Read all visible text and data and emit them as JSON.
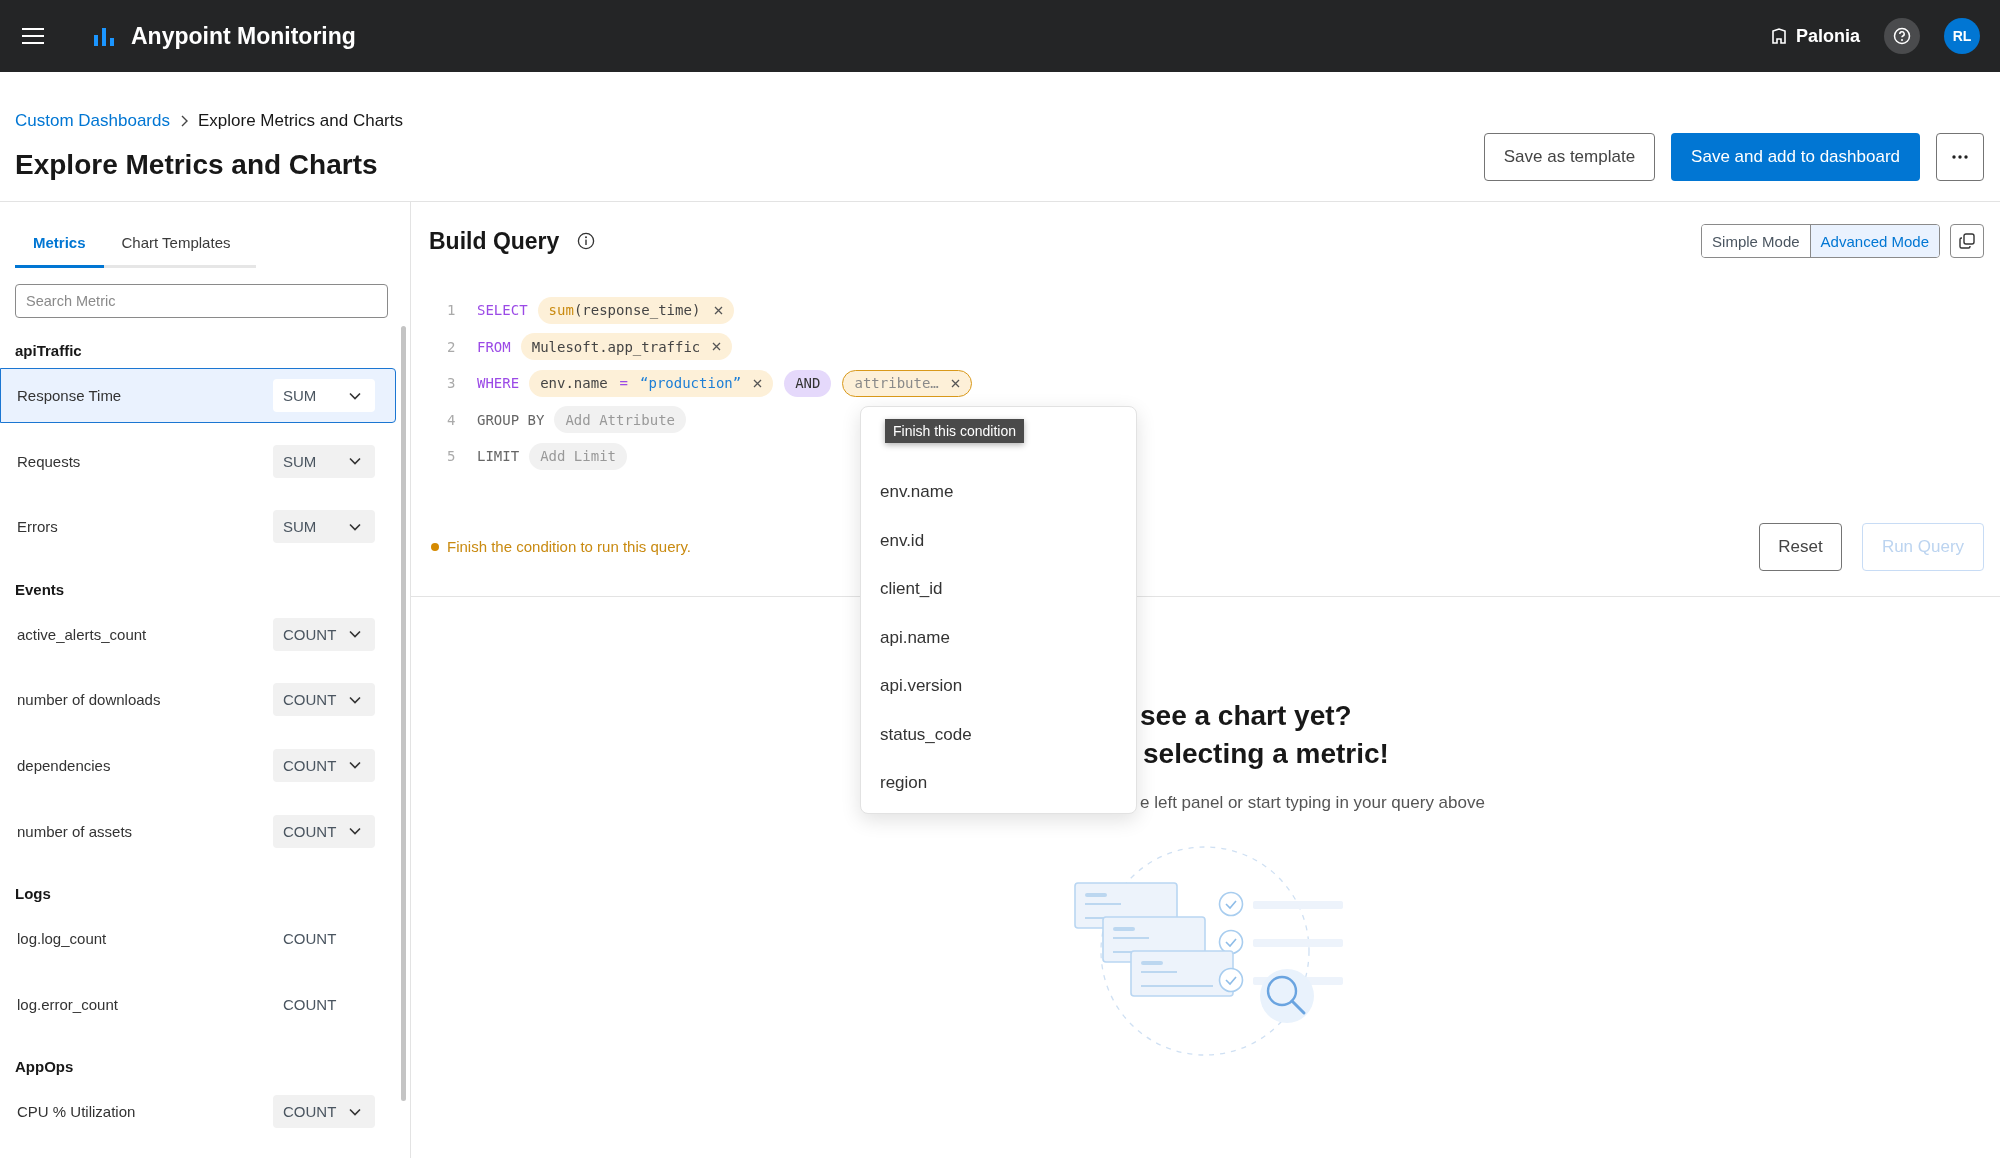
{
  "header": {
    "app_title": "Anypoint Monitoring",
    "org": "Palonia",
    "avatar": "RL"
  },
  "breadcrumb": [
    {
      "label": "Custom Dashboards",
      "kind": "link"
    },
    {
      "label": "Explore Metrics and Charts",
      "kind": "current"
    }
  ],
  "page_title": "Explore Metrics and Charts",
  "actions": {
    "secondary": "Save as template",
    "primary": "Save and add to dashboard"
  },
  "sidebar": {
    "tabs": [
      {
        "label": "Metrics",
        "selected": true
      },
      {
        "label": "Chart Templates",
        "selected": false
      }
    ],
    "search": {
      "placeholder": "Search Metric"
    },
    "groups": [
      {
        "title": "apiTraffic",
        "items": [
          {
            "label": "Response Time",
            "aggregation": "SUM",
            "kind": "select",
            "selected": true
          },
          {
            "label": "Requests",
            "aggregation": "SUM",
            "kind": "select",
            "selected": false
          },
          {
            "label": "Errors",
            "aggregation": "SUM",
            "kind": "select",
            "selected": false
          }
        ]
      },
      {
        "title": "Events",
        "items": [
          {
            "label": "active_alerts_count",
            "aggregation": "COUNT",
            "kind": "select",
            "selected": false
          },
          {
            "label": "number of downloads",
            "aggregation": "COUNT",
            "kind": "select",
            "selected": false
          },
          {
            "label": "dependencies",
            "aggregation": "COUNT",
            "kind": "select",
            "selected": false
          },
          {
            "label": "number of assets",
            "aggregation": "COUNT",
            "kind": "select",
            "selected": false
          }
        ]
      },
      {
        "title": "Logs",
        "items": [
          {
            "label": "log.log_count",
            "aggregation": "COUNT",
            "kind": "text",
            "selected": false
          },
          {
            "label": "log.error_count",
            "aggregation": "COUNT",
            "kind": "text",
            "selected": false
          }
        ]
      },
      {
        "title": "AppOps",
        "items": [
          {
            "label": "CPU % Utilization",
            "aggregation": "COUNT",
            "kind": "select",
            "selected": false
          }
        ]
      }
    ]
  },
  "query": {
    "title": "Build Query",
    "modes": [
      {
        "label": "Simple Mode",
        "selected": false
      },
      {
        "label": "Advanced Mode",
        "selected": true
      }
    ],
    "lines": [
      {
        "number": "1",
        "keyword": "SELECT",
        "active": true,
        "chips": [
          {
            "kind": "function",
            "fn": "sum",
            "text": "(response_time)",
            "removable": true
          }
        ]
      },
      {
        "number": "2",
        "keyword": "FROM",
        "active": true,
        "chips": [
          {
            "kind": "value",
            "text": "Mulesoft.app_traffic",
            "removable": true
          }
        ]
      },
      {
        "number": "3",
        "keyword": "WHERE",
        "active": true,
        "chips": [
          {
            "kind": "condition",
            "attr": "env.name",
            "op": "=",
            "value": "“production”",
            "removable": true
          },
          {
            "kind": "operator",
            "text": "AND",
            "removable": false
          },
          {
            "kind": "incomplete",
            "text": "attribute…",
            "removable": true
          }
        ]
      },
      {
        "number": "4",
        "keyword": "GROUP BY",
        "active": false,
        "chips": [
          {
            "kind": "placeholder",
            "text": "Add Attribute",
            "removable": false
          }
        ]
      },
      {
        "number": "5",
        "keyword": "LIMIT",
        "active": false,
        "chips": [
          {
            "kind": "placeholder",
            "text": "Add Limit",
            "removable": false
          }
        ]
      }
    ],
    "warning": "Finish the condition to run this query.",
    "reset": "Reset",
    "run": {
      "label": "Run Query",
      "disabled": true
    },
    "dropdown": {
      "tooltip": "Finish this condition",
      "options": [
        "env.name",
        "env.id",
        "client_id",
        "api.name",
        "api.version",
        "status_code",
        "region"
      ]
    }
  },
  "empty_state": {
    "heading": [
      "see a chart yet?",
      "selecting a metric!"
    ],
    "text": "e left panel or start typing in your query above"
  }
}
